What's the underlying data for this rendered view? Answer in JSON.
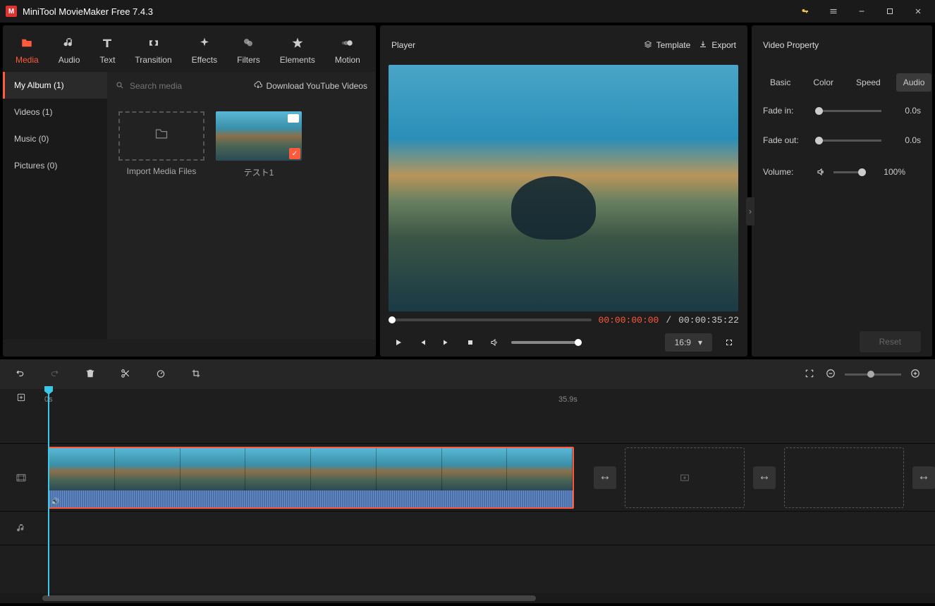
{
  "app": {
    "title": "MiniTool MovieMaker Free 7.4.3"
  },
  "toolbar": {
    "items": [
      {
        "label": "Media",
        "name": "media"
      },
      {
        "label": "Audio",
        "name": "audio"
      },
      {
        "label": "Text",
        "name": "text"
      },
      {
        "label": "Transition",
        "name": "transition"
      },
      {
        "label": "Effects",
        "name": "effects"
      },
      {
        "label": "Filters",
        "name": "filters"
      },
      {
        "label": "Elements",
        "name": "elements"
      },
      {
        "label": "Motion",
        "name": "motion"
      }
    ]
  },
  "sidebar": {
    "items": [
      {
        "label": "My Album (1)"
      },
      {
        "label": "Videos (1)"
      },
      {
        "label": "Music (0)"
      },
      {
        "label": "Pictures (0)"
      }
    ]
  },
  "search": {
    "placeholder": "Search media"
  },
  "ytlink": {
    "label": "Download YouTube Videos"
  },
  "thumbs": {
    "import": "Import Media Files",
    "clip1": "テスト1"
  },
  "player": {
    "title": "Player",
    "template": "Template",
    "export": "Export",
    "current": "00:00:00:00",
    "sep": " / ",
    "total": "00:00:35:22",
    "aspect": "16:9"
  },
  "property": {
    "title": "Video Property",
    "tabs": {
      "basic": "Basic",
      "color": "Color",
      "speed": "Speed",
      "audio": "Audio"
    },
    "fadein": {
      "label": "Fade in:",
      "value": "0.0s"
    },
    "fadeout": {
      "label": "Fade out:",
      "value": "0.0s"
    },
    "volume": {
      "label": "Volume:",
      "value": "100%"
    },
    "reset": "Reset"
  },
  "ruler": {
    "t0": "0s",
    "t1": "35.9s"
  }
}
